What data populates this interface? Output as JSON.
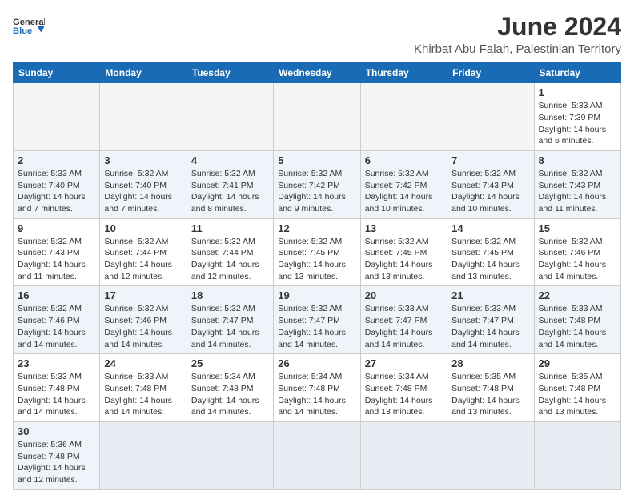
{
  "header": {
    "logo_general": "General",
    "logo_blue": "Blue",
    "month_title": "June 2024",
    "location": "Khirbat Abu Falah, Palestinian Territory"
  },
  "weekdays": [
    "Sunday",
    "Monday",
    "Tuesday",
    "Wednesday",
    "Thursday",
    "Friday",
    "Saturday"
  ],
  "weeks": [
    [
      {
        "day": "",
        "info": ""
      },
      {
        "day": "",
        "info": ""
      },
      {
        "day": "",
        "info": ""
      },
      {
        "day": "",
        "info": ""
      },
      {
        "day": "",
        "info": ""
      },
      {
        "day": "",
        "info": ""
      },
      {
        "day": "1",
        "info": "Sunrise: 5:33 AM\nSunset: 7:39 PM\nDaylight: 14 hours\nand 6 minutes."
      }
    ],
    [
      {
        "day": "2",
        "info": "Sunrise: 5:33 AM\nSunset: 7:40 PM\nDaylight: 14 hours\nand 7 minutes."
      },
      {
        "day": "3",
        "info": "Sunrise: 5:32 AM\nSunset: 7:40 PM\nDaylight: 14 hours\nand 7 minutes."
      },
      {
        "day": "4",
        "info": "Sunrise: 5:32 AM\nSunset: 7:41 PM\nDaylight: 14 hours\nand 8 minutes."
      },
      {
        "day": "5",
        "info": "Sunrise: 5:32 AM\nSunset: 7:42 PM\nDaylight: 14 hours\nand 9 minutes."
      },
      {
        "day": "6",
        "info": "Sunrise: 5:32 AM\nSunset: 7:42 PM\nDaylight: 14 hours\nand 10 minutes."
      },
      {
        "day": "7",
        "info": "Sunrise: 5:32 AM\nSunset: 7:43 PM\nDaylight: 14 hours\nand 10 minutes."
      },
      {
        "day": "8",
        "info": "Sunrise: 5:32 AM\nSunset: 7:43 PM\nDaylight: 14 hours\nand 11 minutes."
      }
    ],
    [
      {
        "day": "9",
        "info": "Sunrise: 5:32 AM\nSunset: 7:43 PM\nDaylight: 14 hours\nand 11 minutes."
      },
      {
        "day": "10",
        "info": "Sunrise: 5:32 AM\nSunset: 7:44 PM\nDaylight: 14 hours\nand 12 minutes."
      },
      {
        "day": "11",
        "info": "Sunrise: 5:32 AM\nSunset: 7:44 PM\nDaylight: 14 hours\nand 12 minutes."
      },
      {
        "day": "12",
        "info": "Sunrise: 5:32 AM\nSunset: 7:45 PM\nDaylight: 14 hours\nand 13 minutes."
      },
      {
        "day": "13",
        "info": "Sunrise: 5:32 AM\nSunset: 7:45 PM\nDaylight: 14 hours\nand 13 minutes."
      },
      {
        "day": "14",
        "info": "Sunrise: 5:32 AM\nSunset: 7:45 PM\nDaylight: 14 hours\nand 13 minutes."
      },
      {
        "day": "15",
        "info": "Sunrise: 5:32 AM\nSunset: 7:46 PM\nDaylight: 14 hours\nand 14 minutes."
      }
    ],
    [
      {
        "day": "16",
        "info": "Sunrise: 5:32 AM\nSunset: 7:46 PM\nDaylight: 14 hours\nand 14 minutes."
      },
      {
        "day": "17",
        "info": "Sunrise: 5:32 AM\nSunset: 7:46 PM\nDaylight: 14 hours\nand 14 minutes."
      },
      {
        "day": "18",
        "info": "Sunrise: 5:32 AM\nSunset: 7:47 PM\nDaylight: 14 hours\nand 14 minutes."
      },
      {
        "day": "19",
        "info": "Sunrise: 5:32 AM\nSunset: 7:47 PM\nDaylight: 14 hours\nand 14 minutes."
      },
      {
        "day": "20",
        "info": "Sunrise: 5:33 AM\nSunset: 7:47 PM\nDaylight: 14 hours\nand 14 minutes."
      },
      {
        "day": "21",
        "info": "Sunrise: 5:33 AM\nSunset: 7:47 PM\nDaylight: 14 hours\nand 14 minutes."
      },
      {
        "day": "22",
        "info": "Sunrise: 5:33 AM\nSunset: 7:48 PM\nDaylight: 14 hours\nand 14 minutes."
      }
    ],
    [
      {
        "day": "23",
        "info": "Sunrise: 5:33 AM\nSunset: 7:48 PM\nDaylight: 14 hours\nand 14 minutes."
      },
      {
        "day": "24",
        "info": "Sunrise: 5:33 AM\nSunset: 7:48 PM\nDaylight: 14 hours\nand 14 minutes."
      },
      {
        "day": "25",
        "info": "Sunrise: 5:34 AM\nSunset: 7:48 PM\nDaylight: 14 hours\nand 14 minutes."
      },
      {
        "day": "26",
        "info": "Sunrise: 5:34 AM\nSunset: 7:48 PM\nDaylight: 14 hours\nand 14 minutes."
      },
      {
        "day": "27",
        "info": "Sunrise: 5:34 AM\nSunset: 7:48 PM\nDaylight: 14 hours\nand 13 minutes."
      },
      {
        "day": "28",
        "info": "Sunrise: 5:35 AM\nSunset: 7:48 PM\nDaylight: 14 hours\nand 13 minutes."
      },
      {
        "day": "29",
        "info": "Sunrise: 5:35 AM\nSunset: 7:48 PM\nDaylight: 14 hours\nand 13 minutes."
      }
    ],
    [
      {
        "day": "30",
        "info": "Sunrise: 5:36 AM\nSunset: 7:48 PM\nDaylight: 14 hours\nand 12 minutes."
      },
      {
        "day": "",
        "info": ""
      },
      {
        "day": "",
        "info": ""
      },
      {
        "day": "",
        "info": ""
      },
      {
        "day": "",
        "info": ""
      },
      {
        "day": "",
        "info": ""
      },
      {
        "day": "",
        "info": ""
      }
    ]
  ]
}
